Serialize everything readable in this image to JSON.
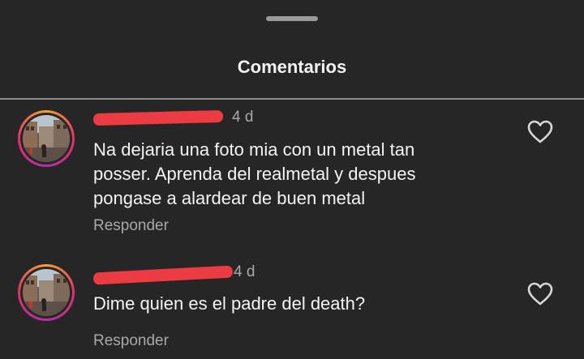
{
  "sheet": {
    "title": "Comentarios"
  },
  "comments": [
    {
      "time": "4 d",
      "text": "Na dejaria una foto mia con un metal tan\nposser. Aprenda del realmetal y despues\npongase a alardear de buen metal",
      "reply_label": "Responder",
      "like_icon": "heart-outline-icon"
    },
    {
      "time": "4 d",
      "text": "Dime quien es el padre del death?",
      "reply_label": "Responder",
      "like_icon": "heart-outline-icon"
    }
  ],
  "colors": {
    "background": "#262626",
    "redaction": "#ec3b43",
    "secondary_text": "#a8a8a8",
    "story_ring_start": "#f8a12a",
    "story_ring_end": "#b82da8"
  }
}
